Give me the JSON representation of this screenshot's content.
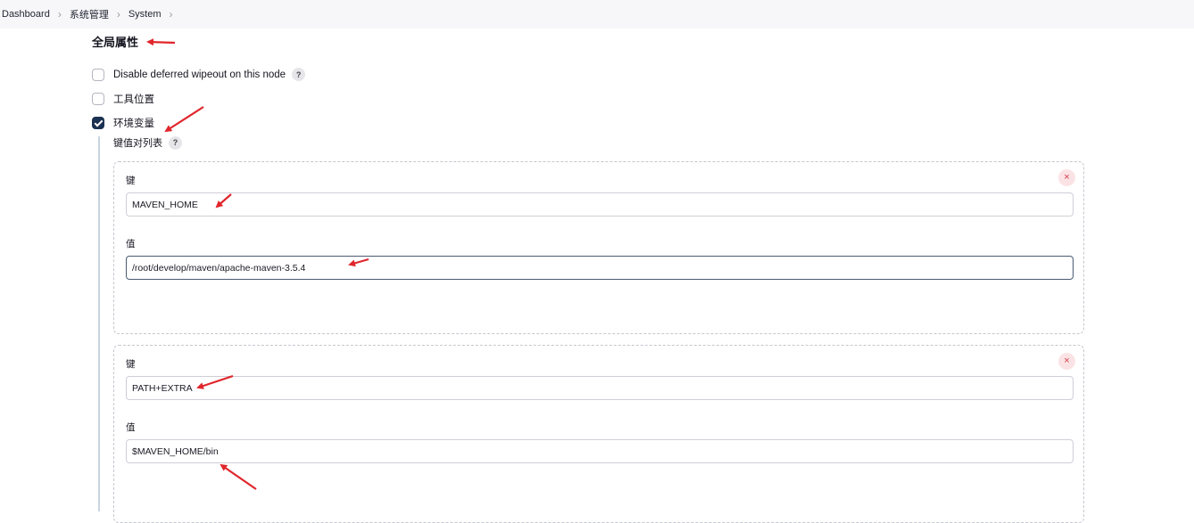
{
  "breadcrumb": [
    "Dashboard",
    "系统管理",
    "System"
  ],
  "section_title": "全局属性",
  "checkboxes": [
    {
      "label": "Disable deferred wipeout on this node",
      "checked": false,
      "help": "?"
    },
    {
      "label": "工具位置",
      "checked": false
    },
    {
      "label": "环境变量",
      "checked": true
    }
  ],
  "env": {
    "list_label": "键值对列表",
    "help": "?",
    "key_label": "键",
    "value_label": "值",
    "delete_icon": "×",
    "entries": [
      {
        "key": "MAVEN_HOME",
        "value": "/root/develop/maven/apache-maven-3.5.4"
      },
      {
        "key": "PATH+EXTRA",
        "value": "$MAVEN_HOME/bin"
      }
    ]
  },
  "annotation_color": "#e0262c"
}
